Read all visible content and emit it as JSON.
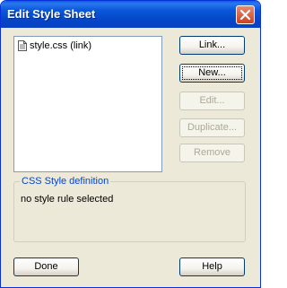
{
  "window": {
    "title": "Edit Style Sheet"
  },
  "stylesheet_list": {
    "items": [
      {
        "label": "style.css (link)"
      }
    ]
  },
  "buttons": {
    "link": "Link...",
    "new": "New...",
    "edit": "Edit...",
    "duplicate": "Duplicate...",
    "remove": "Remove",
    "done": "Done",
    "help": "Help"
  },
  "css_definition": {
    "legend": "CSS Style definition",
    "text": "no style rule selected"
  },
  "colors": {
    "title_bar": "#0a58d8",
    "dialog_bg": "#ece9d8",
    "group_legend": "#0046d5",
    "close_button": "#d0401c"
  },
  "icons": {
    "close": "close-icon",
    "file": "css-file-icon"
  }
}
